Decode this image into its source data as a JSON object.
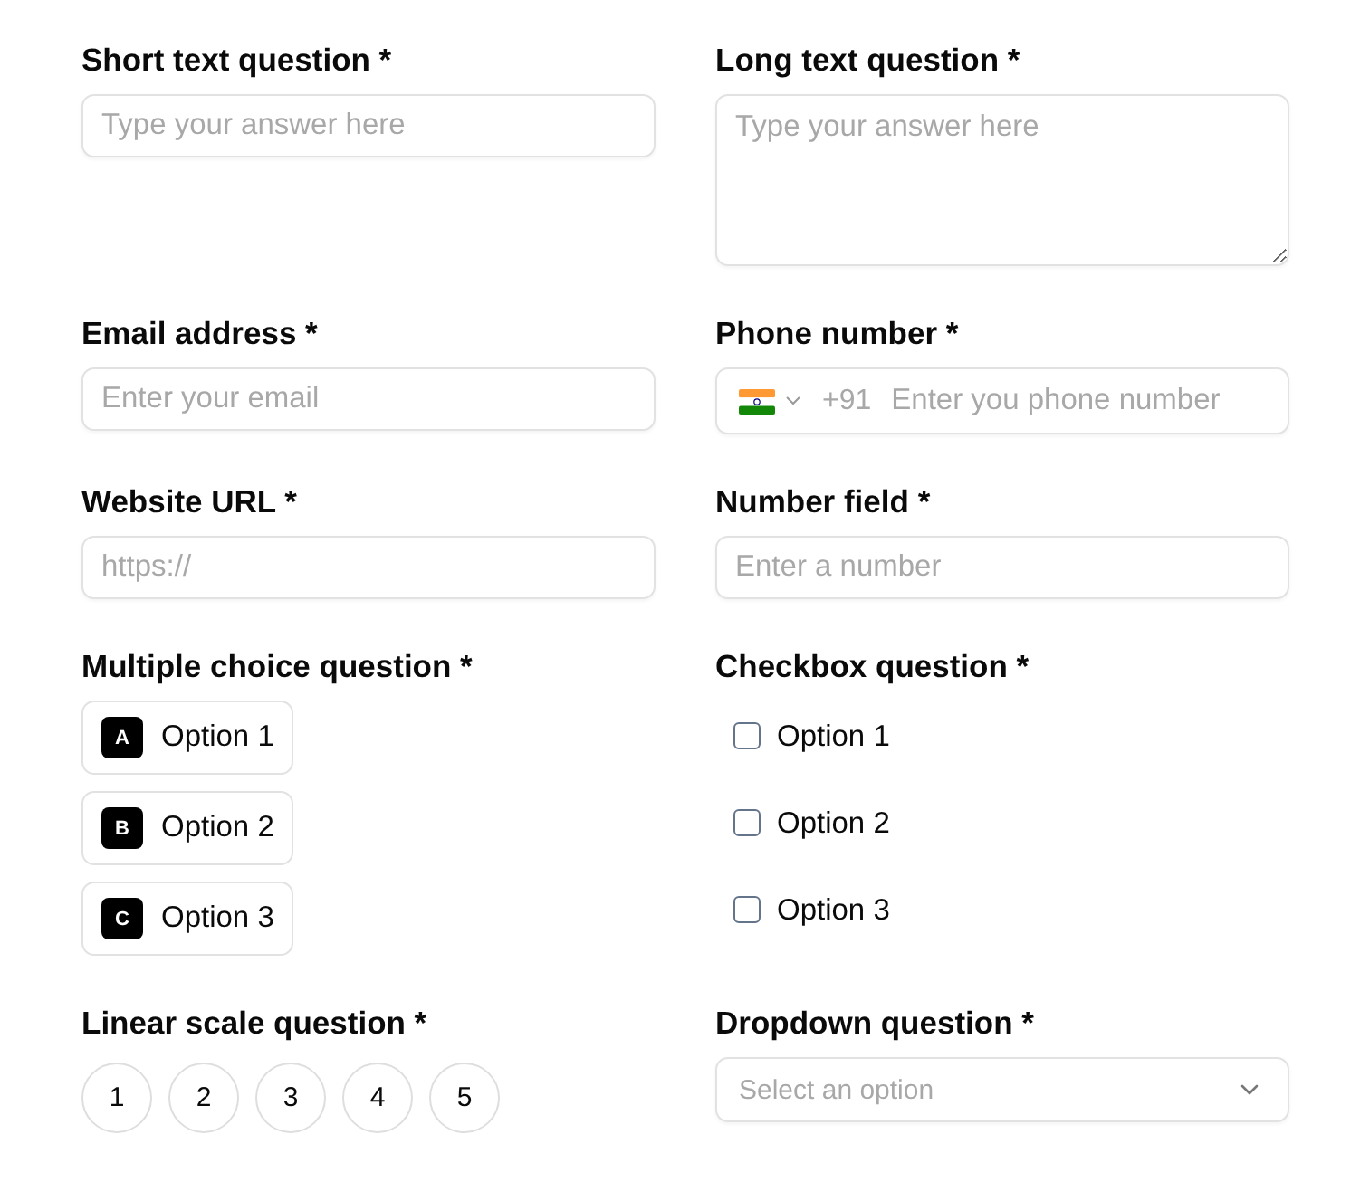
{
  "questions": [
    {
      "kind": "short_text",
      "label": "Short text question *",
      "placeholder": "Type your answer here"
    },
    {
      "kind": "long_text",
      "label": "Long text question *",
      "placeholder": "Type your answer here"
    },
    {
      "kind": "email",
      "label": "Email address *",
      "placeholder": "Enter your email"
    },
    {
      "kind": "phone",
      "label": "Phone number *",
      "dial_code": "+91",
      "placeholder": "Enter you phone number"
    },
    {
      "kind": "url",
      "label": "Website URL *",
      "placeholder": "https://"
    },
    {
      "kind": "number",
      "label": "Number field *",
      "placeholder": "Enter a number"
    },
    {
      "kind": "multiple_choice",
      "label": "Multiple choice question *",
      "options": [
        {
          "key": "A",
          "label": "Option 1",
          "selected": false
        },
        {
          "key": "B",
          "label": "Option 2",
          "selected": false
        },
        {
          "key": "C",
          "label": "Option 3",
          "selected": false
        }
      ]
    },
    {
      "kind": "checkbox",
      "label": "Checkbox question *",
      "options": [
        {
          "label": "Option 1",
          "checked": false
        },
        {
          "label": "Option 2",
          "checked": false
        },
        {
          "label": "Option 3",
          "checked": false
        }
      ]
    },
    {
      "kind": "linear_scale",
      "label": "Linear scale question *",
      "options": [
        {
          "label": "1",
          "selected": false
        },
        {
          "label": "2",
          "selected": false
        },
        {
          "label": "3",
          "selected": false
        },
        {
          "label": "4",
          "selected": false
        },
        {
          "label": "5",
          "selected": false
        }
      ]
    },
    {
      "kind": "dropdown",
      "label": "Dropdown question *",
      "placeholder": "Select an option"
    }
  ]
}
